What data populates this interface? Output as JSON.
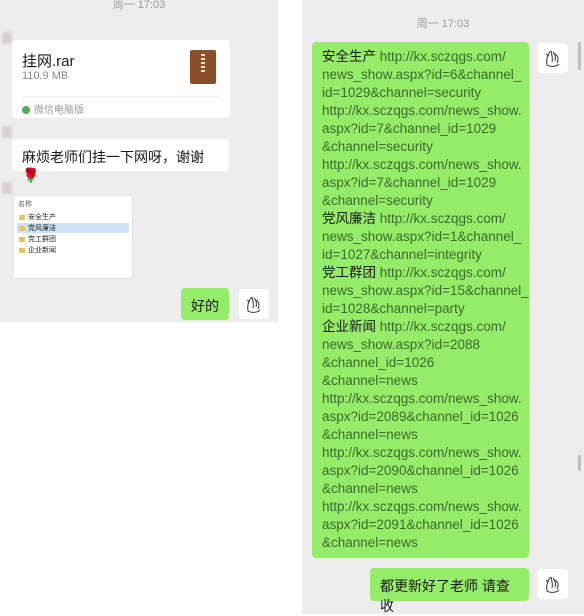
{
  "left": {
    "time": "周一 17:03",
    "file": {
      "name": "挂网.rar",
      "size": "110.9 MB",
      "source": "微信电脑版"
    },
    "msg1": "麻烦老师们挂一下网呀，谢谢🌹",
    "screenshot": {
      "header": "名称",
      "folders": [
        "安全生产",
        "党风廉洁",
        "党工群团",
        "企业新闻"
      ]
    },
    "reply": "好的"
  },
  "right": {
    "time": "周一 17:03",
    "message_lines": [
      [
        "安全生产 ",
        "http://kx.sczqgs.com/"
      ],
      [
        "",
        "news_show.aspx?id=6&channel_"
      ],
      [
        "",
        "id=1029&channel=security"
      ],
      [
        "",
        "http://kx.sczqgs.com/news_show."
      ],
      [
        "",
        "aspx?id=7&channel_id=1029"
      ],
      [
        "",
        "&channel=security"
      ],
      [
        "",
        "http://kx.sczqgs.com/news_show."
      ],
      [
        "",
        "aspx?id=7&channel_id=1029"
      ],
      [
        "",
        "&channel=security"
      ],
      [
        "党风廉洁 ",
        "http://kx.sczqgs.com/"
      ],
      [
        "",
        "news_show.aspx?id=1&channel_"
      ],
      [
        "",
        "id=1027&channel=integrity"
      ],
      [
        "党工群团 ",
        "http://kx.sczqgs.com/"
      ],
      [
        "",
        "news_show.aspx?id=15&channel_"
      ],
      [
        "",
        "id=1028&channel=party"
      ],
      [
        "企业新闻 ",
        "http://kx.sczqgs.com/"
      ],
      [
        "",
        "news_show.aspx?id=2088"
      ],
      [
        "",
        "&channel_id=1026"
      ],
      [
        "",
        "&channel=news"
      ],
      [
        "",
        "http://kx.sczqgs.com/news_show."
      ],
      [
        "",
        "aspx?id=2089&channel_id=1026"
      ],
      [
        "",
        "&channel=news"
      ],
      [
        "",
        "http://kx.sczqgs.com/news_show."
      ],
      [
        "",
        "aspx?id=2090&channel_id=1026"
      ],
      [
        "",
        "&channel=news"
      ],
      [
        "",
        "http://kx.sczqgs.com/news_show."
      ],
      [
        "",
        "aspx?id=2091&channel_id=1026"
      ],
      [
        "",
        "&channel=news"
      ]
    ],
    "reply": "都更新好了老师 请查收"
  },
  "colors": {
    "bubble_green": "#95ec69",
    "panel_bg": "#ededed"
  },
  "icons": [
    "rar-file-icon",
    "wechat-pc-icon",
    "hand-sketch-avatar-icon",
    "folder-icon"
  ]
}
